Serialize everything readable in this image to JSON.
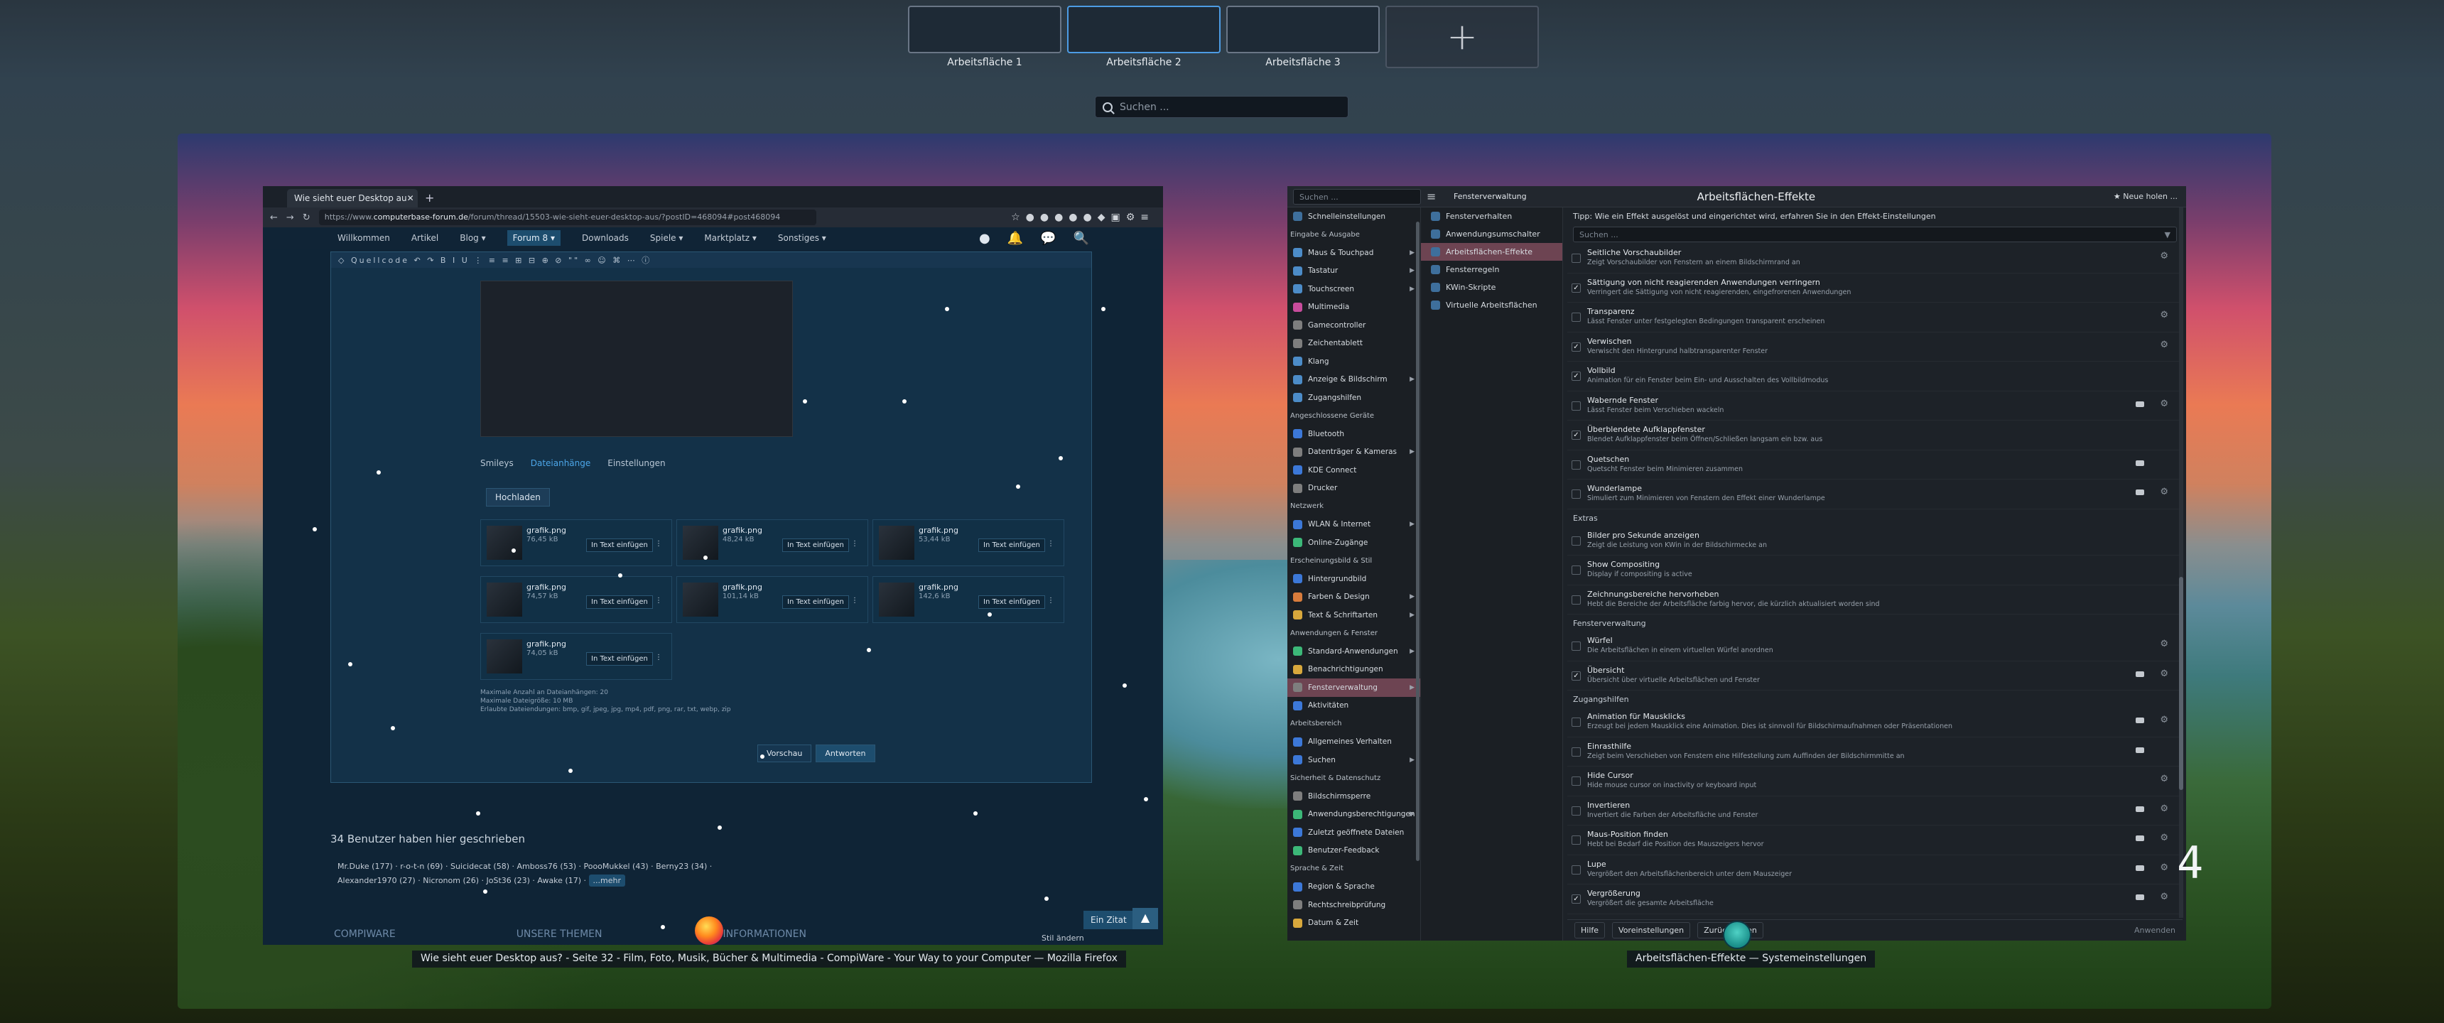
{
  "workspaces": [
    {
      "label": "Arbeitsfläche 1"
    },
    {
      "label": "Arbeitsfläche 2"
    },
    {
      "label": "Arbeitsfläche 3"
    }
  ],
  "add_workspace": "+",
  "search_placeholder": "Suchen ...",
  "firefox": {
    "tab_title": "Wie sieht euer Desktop au",
    "url_prefix": "https://www.",
    "url_domain": "computerbase-forum.de",
    "url_rest": "/forum/thread/15503-wie-sieht-euer-desktop-aus/?postID=468094#post468094",
    "nav": [
      "Willkommen",
      "Artikel",
      "Blog ▾",
      "Forum 8 ▾",
      "Downloads",
      "Spiele ▾",
      "Marktplatz ▾",
      "Sonstiges ▾"
    ],
    "editor_tabs": [
      "Smileys",
      "Dateianhänge",
      "Einstellungen"
    ],
    "upload_label": "Hochladen",
    "attachments": [
      {
        "name": "grafik.png",
        "size": "76,45 kB"
      },
      {
        "name": "grafik.png",
        "size": "48,24 kB"
      },
      {
        "name": "grafik.png",
        "size": "53,44 kB"
      },
      {
        "name": "grafik.png",
        "size": "74,57 kB"
      },
      {
        "name": "grafik.png",
        "size": "101,14 kB"
      },
      {
        "name": "grafik.png",
        "size": "142,6 kB"
      },
      {
        "name": "grafik.png",
        "size": "74,05 kB"
      }
    ],
    "insert_label": "In Text einfügen",
    "limits": [
      "Maximale Anzahl an Dateianhängen: 20",
      "Maximale Dateigröße: 10 MB",
      "Erlaubte Dateiendungen: bmp, gif, jpeg, jpg, mp4, pdf, png, rar, txt, webp, zip"
    ],
    "preview_label": "Vorschau",
    "reply_label": "Antworten",
    "users_heading": "34 Benutzer haben hier geschrieben",
    "users_line1": "Mr.Duke (177) · r-o-t-n (69) · Suicidecat (58) · Amboss76 (53) · PoooMukkel (43) · Berny23 (34) ·",
    "users_line2": "Alexander1970 (27) · Nicronom (26) · JoSt36 (23) · Awake (17) ·",
    "more_label": "...mehr",
    "footer": [
      "COMPIWARE",
      "UNSERE THEMEN",
      "INFORMATIONEN"
    ],
    "style_label": "Stil ändern",
    "quote_label": "Ein Zitat",
    "caption": "Wie sieht euer Desktop aus? - Seite 32 - Film, Foto, Musik, Bücher & Multimedia - CompiWare - Your Way to your Computer — Mozilla Firefox"
  },
  "settings": {
    "search_placeholder": "Suchen ...",
    "header_section": "Fensterverwaltung",
    "page_title": "Arbeitsflächen-Effekte",
    "new_button": "Neue holen ...",
    "sidebar": [
      {
        "label": "Schnelleinstellungen",
        "color": "#3e6f9c"
      },
      {
        "label": "Eingabe & Ausgabe",
        "cat": true
      },
      {
        "label": "Maus & Touchpad",
        "color": "#4c8cc8",
        "arrow": true
      },
      {
        "label": "Tastatur",
        "color": "#4c8cc8",
        "arrow": true
      },
      {
        "label": "Touchscreen",
        "color": "#4c8cc8",
        "arrow": true
      },
      {
        "label": "Multimedia",
        "color": "#c84c9c"
      },
      {
        "label": "Gamecontroller",
        "color": "#7e7e7e"
      },
      {
        "label": "Zeichentablett",
        "color": "#7e7e7e"
      },
      {
        "label": "Klang",
        "color": "#4c8cc8"
      },
      {
        "label": "Anzeige & Bildschirm",
        "color": "#4c8cc8",
        "arrow": true
      },
      {
        "label": "Zugangshilfen",
        "color": "#4c8cc8"
      },
      {
        "label": "Angeschlossene Geräte",
        "cat": true
      },
      {
        "label": "Bluetooth",
        "color": "#3c78d8"
      },
      {
        "label": "Datenträger & Kameras",
        "color": "#7e7e7e",
        "arrow": true
      },
      {
        "label": "KDE Connect",
        "color": "#3c78d8"
      },
      {
        "label": "Drucker",
        "color": "#7e7e7e"
      },
      {
        "label": "Netzwerk",
        "cat": true
      },
      {
        "label": "WLAN & Internet",
        "color": "#3c78d8",
        "arrow": true
      },
      {
        "label": "Online-Zugänge",
        "color": "#3cb878"
      },
      {
        "label": "Erscheinungsbild & Stil",
        "cat": true
      },
      {
        "label": "Hintergrundbild",
        "color": "#3c78d8"
      },
      {
        "label": "Farben & Design",
        "color": "#d87c3c",
        "arrow": true
      },
      {
        "label": "Text & Schriftarten",
        "color": "#d8a83c",
        "arrow": true
      },
      {
        "label": "Anwendungen & Fenster",
        "cat": true
      },
      {
        "label": "Standard-Anwendungen",
        "color": "#3cb878",
        "arrow": true
      },
      {
        "label": "Benachrichtigungen",
        "color": "#d8a83c"
      },
      {
        "label": "Fensterverwaltung",
        "color": "#7e7e7e",
        "arrow": true,
        "selected": true
      },
      {
        "label": "Aktivitäten",
        "color": "#3c78d8"
      },
      {
        "label": "Arbeitsbereich",
        "cat": true
      },
      {
        "label": "Allgemeines Verhalten",
        "color": "#3c78d8"
      },
      {
        "label": "Suchen",
        "color": "#3c78d8",
        "arrow": true
      },
      {
        "label": "Sicherheit & Datenschutz",
        "cat": true
      },
      {
        "label": "Bildschirmsperre",
        "color": "#7e7e7e"
      },
      {
        "label": "Anwendungsberechtigungen",
        "color": "#3cb878",
        "arrow": true
      },
      {
        "label": "Zuletzt geöffnete Dateien",
        "color": "#3c78d8"
      },
      {
        "label": "Benutzer-Feedback",
        "color": "#3cb878"
      },
      {
        "label": "Sprache & Zeit",
        "cat": true
      },
      {
        "label": "Region & Sprache",
        "color": "#3c78d8"
      },
      {
        "label": "Rechtschreibprüfung",
        "color": "#7e7e7e"
      },
      {
        "label": "Datum & Zeit",
        "color": "#d8a83c"
      }
    ],
    "subpages": [
      {
        "label": "Fensterverhalten"
      },
      {
        "label": "Anwendungsumschalter"
      },
      {
        "label": "Arbeitsflächen-Effekte",
        "selected": true
      },
      {
        "label": "Fensterregeln"
      },
      {
        "label": "KWin-Skripte"
      },
      {
        "label": "Virtuelle Arbeitsflächen"
      }
    ],
    "tip": "Tipp: Wie ein Effekt ausgelöst und eingerichtet wird, erfahren Sie in den Effekt-Einstellungen",
    "effects_search": "Suchen ...",
    "effects": [
      {
        "title": "Seitliche Vorschaubilder",
        "desc": "Zeigt Vorschaubilder von Fenstern an einem Bildschirmrand an",
        "checked": false,
        "gear": true
      },
      {
        "title": "Sättigung von nicht reagierenden Anwendungen verringern",
        "desc": "Verringert die Sättigung von nicht reagierenden, eingefrorenen Anwendungen",
        "checked": true
      },
      {
        "title": "Transparenz",
        "desc": "Lässt Fenster unter festgelegten Bedingungen transparent erscheinen",
        "checked": false,
        "gear": true
      },
      {
        "title": "Verwischen",
        "desc": "Verwischt den Hintergrund halbtransparenter Fenster",
        "checked": true,
        "gear": true
      },
      {
        "title": "Vollbild",
        "desc": "Animation für ein Fenster beim Ein- und Ausschalten des Vollbildmodus",
        "checked": true
      },
      {
        "title": "Wabernde Fenster",
        "desc": "Lässt Fenster beim Verschieben wackeln",
        "checked": false,
        "video": true,
        "gear": true
      },
      {
        "title": "Überblendete Aufklappfenster",
        "desc": "Blendet Aufklappfenster beim Öffnen/Schließen langsam ein bzw. aus",
        "checked": true
      },
      {
        "title": "Quetschen",
        "desc": "Quetscht Fenster beim Minimieren zusammen",
        "checked": false,
        "video": true
      },
      {
        "title": "Wunderlampe",
        "desc": "Simuliert zum Minimieren von Fenstern den Effekt einer Wunderlampe",
        "checked": false,
        "video": true,
        "gear": true
      },
      {
        "group": "Extras"
      },
      {
        "title": "Bilder pro Sekunde anzeigen",
        "desc": "Zeigt die Leistung von KWin in der Bildschirmecke an",
        "checked": false
      },
      {
        "title": "Show Compositing",
        "desc": "Display if compositing is active",
        "checked": false
      },
      {
        "title": "Zeichnungsbereiche hervorheben",
        "desc": "Hebt die Bereiche der Arbeitsfläche farbig hervor, die kürzlich aktualisiert worden sind",
        "checked": false
      },
      {
        "group": "Fensterverwaltung"
      },
      {
        "title": "Würfel",
        "desc": "Die Arbeitsflächen in einem virtuellen Würfel anordnen",
        "checked": false,
        "gear": true
      },
      {
        "title": "Übersicht",
        "desc": "Übersicht über virtuelle Arbeitsflächen und Fenster",
        "checked": true,
        "video": true,
        "gear": true
      },
      {
        "group": "Zugangshilfen"
      },
      {
        "title": "Animation für Mausklicks",
        "desc": "Erzeugt bei jedem Mausklick eine Animation. Dies ist sinnvoll für Bildschirmaufnahmen oder Präsentationen",
        "checked": false,
        "video": true,
        "gear": true
      },
      {
        "title": "Einrasthilfe",
        "desc": "Zeigt beim Verschieben von Fenstern eine Hilfestellung zum Auffinden der Bildschirmmitte an",
        "checked": false,
        "video": true
      },
      {
        "title": "Hide Cursor",
        "desc": "Hide mouse cursor on inactivity or keyboard input",
        "checked": false,
        "gear": true
      },
      {
        "title": "Invertieren",
        "desc": "Invertiert die Farben der Arbeitsfläche und Fenster",
        "checked": false,
        "video": true,
        "gear": true
      },
      {
        "title": "Maus-Position finden",
        "desc": "Hebt bei Bedarf die Position des Mauszeigers hervor",
        "checked": false,
        "video": true,
        "gear": true
      },
      {
        "title": "Lupe",
        "desc": "Vergrößert den Arbeitsflächenbereich unter dem Mauszeiger",
        "checked": false,
        "video": true,
        "gear": true
      },
      {
        "title": "Vergrößerung",
        "desc": "Vergrößert die gesamte Arbeitsfläche",
        "checked": true,
        "video": true,
        "gear": true
      }
    ],
    "help_label": "Hilfe",
    "defaults_label": "Voreinstellungen",
    "reset_label": "Zurücksetzen",
    "apply_label": "Anwenden",
    "caption": "Arbeitsflächen-Effekte — Systemeinstellungen"
  },
  "clock_digit": "4"
}
